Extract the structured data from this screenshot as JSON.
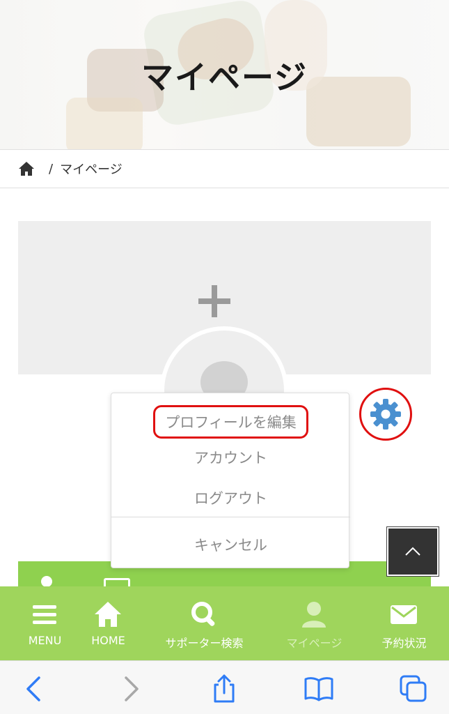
{
  "hero": {
    "title": "マイページ"
  },
  "breadcrumb": {
    "home_icon": "home-icon",
    "separator": "/",
    "current": "マイページ"
  },
  "profile": {
    "cover_add_icon": "plus-icon",
    "avatar_icon": "avatar-placeholder",
    "settings_icon": "gear-icon"
  },
  "dropdown": {
    "items": [
      {
        "label": "プロフィールを編集",
        "highlighted": true
      },
      {
        "label": "アカウント"
      },
      {
        "label": "ログアウト"
      }
    ],
    "cancel": "キャンセル"
  },
  "bottom_nav": {
    "items": [
      {
        "label": "MENU",
        "icon": "menu-icon"
      },
      {
        "label": "HOME",
        "icon": "home-icon"
      },
      {
        "label": "サポーター検索",
        "icon": "search-icon"
      },
      {
        "label": "マイページ",
        "icon": "user-icon",
        "active": true
      },
      {
        "label": "予約状況",
        "icon": "mail-icon"
      }
    ]
  },
  "browser_toolbar": {
    "buttons": [
      "back-icon",
      "forward-icon",
      "share-icon",
      "bookmarks-icon",
      "tabs-icon"
    ]
  },
  "colors": {
    "nav_green": "#9fd55c",
    "gear_blue": "#4a90d0",
    "highlight_red": "#e01010"
  }
}
